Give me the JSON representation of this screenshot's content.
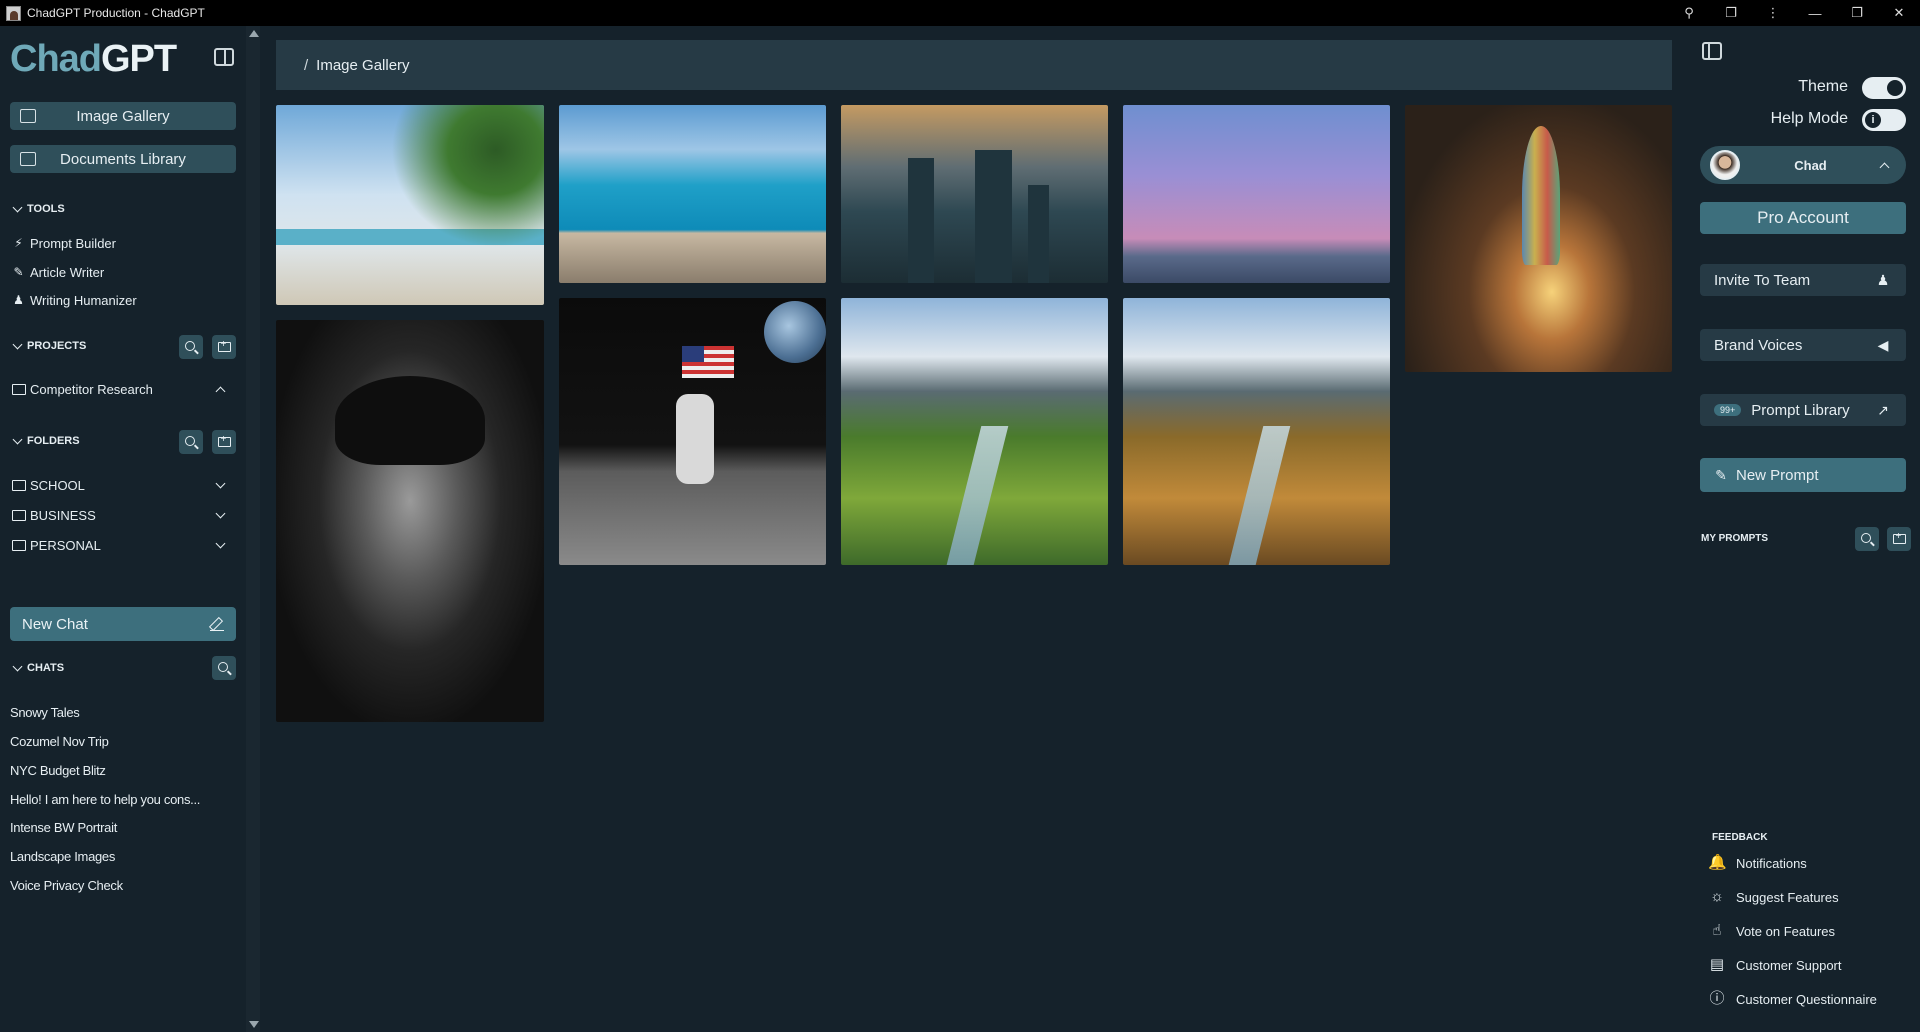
{
  "window": {
    "title": "ChadGPT Production - ChadGPT"
  },
  "logo": {
    "part1": "Chad",
    "part2": "GPT"
  },
  "nav": {
    "image_gallery": "Image Gallery",
    "documents_library": "Documents Library"
  },
  "tools": {
    "heading": "TOOLS",
    "items": [
      "Prompt Builder",
      "Article Writer",
      "Writing Humanizer"
    ]
  },
  "projects": {
    "heading": "PROJECTS",
    "items": [
      "Competitor Research"
    ]
  },
  "folders": {
    "heading": "FOLDERS",
    "items": [
      "SCHOOL",
      "BUSINESS",
      "PERSONAL"
    ]
  },
  "new_chat": "New Chat",
  "chats": {
    "heading": "CHATS",
    "items": [
      "Snowy Tales",
      "Cozumel Nov Trip",
      "NYC Budget Blitz",
      "Hello! I am here to help you cons...",
      "Intense BW Portrait",
      "Landscape Images",
      "Voice Privacy Check"
    ]
  },
  "breadcrumb": {
    "separator": "/",
    "current": "Image Gallery"
  },
  "right_panel": {
    "theme_label": "Theme",
    "help_mode_label": "Help Mode",
    "user_name": "Chad",
    "pro_account": "Pro Account",
    "invite_to_team": "Invite To Team",
    "brand_voices": "Brand Voices",
    "prompt_library_badge": "99+",
    "prompt_library": "Prompt Library",
    "new_prompt": "New Prompt",
    "my_prompts": "MY PROMPTS",
    "feedback_heading": "FEEDBACK",
    "feedback_items": [
      "Notifications",
      "Suggest Features",
      "Vote on Features",
      "Customer Support",
      "Customer Questionnaire"
    ]
  },
  "colors": {
    "accent": "#3d6f7d",
    "background": "#15222b",
    "panel": "#263a45"
  }
}
